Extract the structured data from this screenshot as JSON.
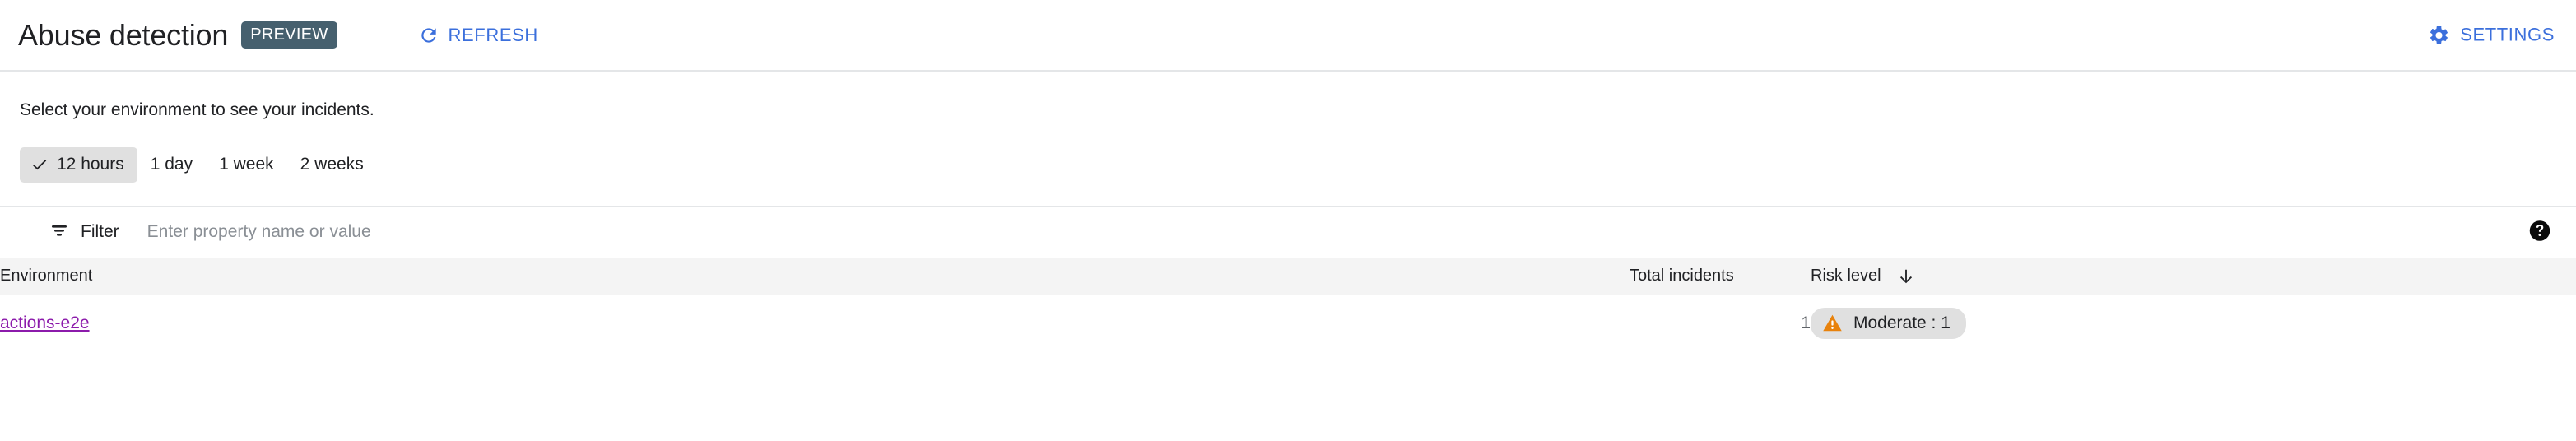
{
  "header": {
    "title": "Abuse detection",
    "preview_badge": "PREVIEW",
    "refresh_label": "REFRESH",
    "refresh_icon": "refresh-icon",
    "settings_label": "SETTINGS",
    "settings_icon": "gear-icon",
    "accent_color": "#3b6fdc",
    "preview_badge_color": "#46606e"
  },
  "main": {
    "subtitle": "Select your environment to see your incidents.",
    "time_ranges": [
      {
        "label": "12 hours",
        "selected": true
      },
      {
        "label": "1 day",
        "selected": false
      },
      {
        "label": "1 week",
        "selected": false
      },
      {
        "label": "2 weeks",
        "selected": false
      }
    ],
    "filter": {
      "icon": "filter-icon",
      "label": "Filter",
      "placeholder": "Enter property name or value",
      "value": "",
      "help_icon": "help-circle-icon"
    },
    "table": {
      "columns": {
        "environment": "Environment",
        "total_incidents": "Total incidents",
        "risk_level": "Risk level"
      },
      "sort": {
        "column": "risk_level",
        "direction": "descending",
        "icon": "arrow-down-icon"
      },
      "rows": [
        {
          "environment": "actions-e2e",
          "environment_link_color": "#8c1bab",
          "total_incidents": "1",
          "risk_badge": {
            "icon": "warning-triangle-icon",
            "icon_color": "#e8820c",
            "label": "Moderate : 1"
          }
        }
      ]
    }
  }
}
